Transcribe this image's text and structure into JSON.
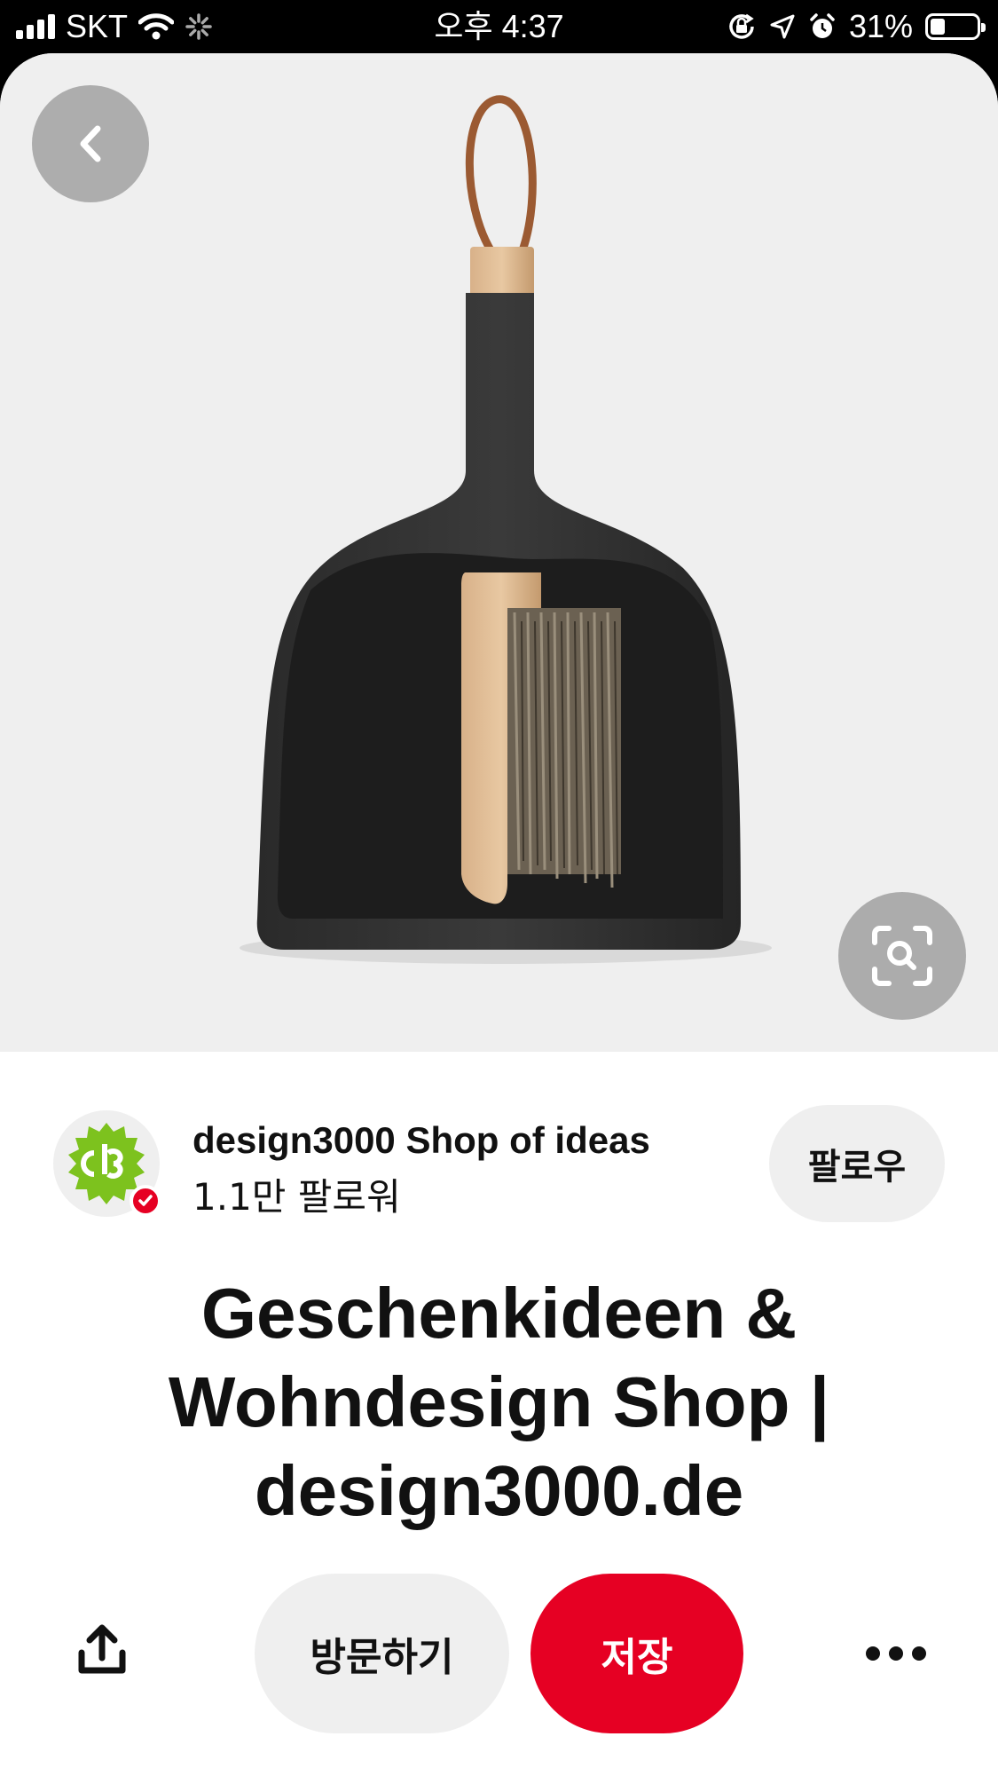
{
  "status_bar": {
    "carrier": "SKT",
    "time": "오후 4:37",
    "battery_percent": "31%",
    "battery_level": 0.31,
    "icons": [
      "signal-icon",
      "wifi-icon",
      "activity-spinner-icon",
      "orientation-lock-icon",
      "location-icon",
      "alarm-icon",
      "battery-icon"
    ]
  },
  "hero": {
    "image_subject": "black dustpan with wooden brush",
    "back_icon": "chevron-left-icon",
    "lens_icon": "visual-search-icon"
  },
  "creator": {
    "name": "design3000 Shop of ideas",
    "followers": "1.1만 팔로워",
    "follow_label": "팔로우",
    "avatar_color": "#7dc21e",
    "verified_color": "#e60023"
  },
  "pin": {
    "title": "Geschenkideen & Wohndesign Shop | design3000.de"
  },
  "actions": {
    "share_icon": "share-icon",
    "visit_label": "방문하기",
    "save_label": "저장",
    "more_icon": "more-icon"
  },
  "colors": {
    "accent": "#e60023",
    "button_gray": "#efefef",
    "text": "#111111"
  }
}
